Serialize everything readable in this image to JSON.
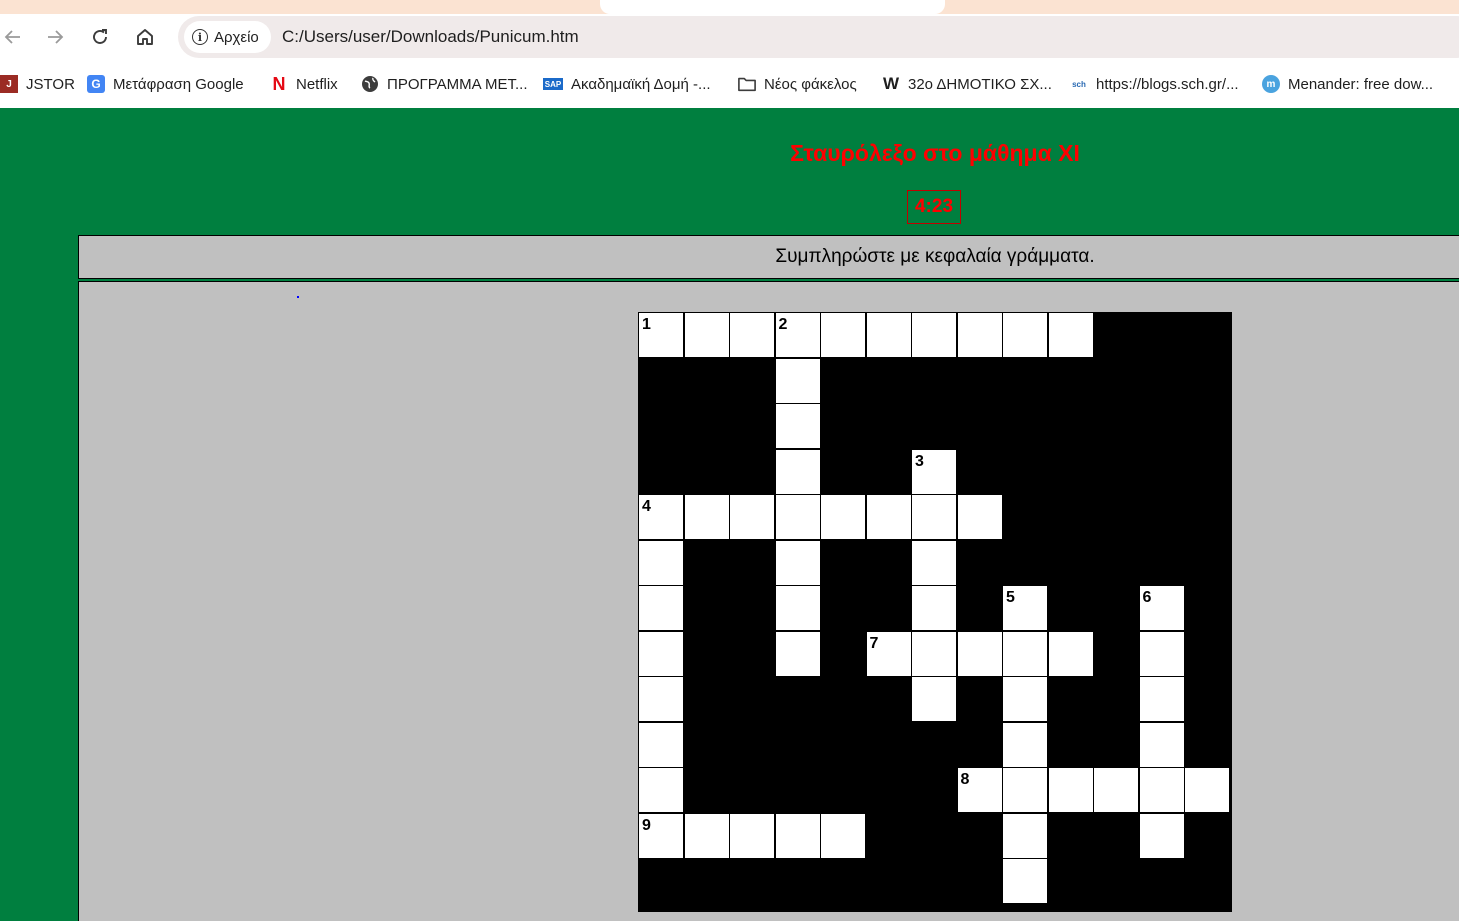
{
  "browser": {
    "nav": {
      "back_icon": "arrow-left-icon",
      "forward_icon": "arrow-right-icon",
      "reload_icon": "reload-icon",
      "home_icon": "home-icon"
    },
    "site_chip_label": "Αρχείο",
    "url": "C:/Users/user/Downloads/Punicum.htm"
  },
  "bookmarks": [
    {
      "label": "JSTOR",
      "icon": "jstor-icon"
    },
    {
      "label": "Μετάφραση Google",
      "icon": "google-translate-icon"
    },
    {
      "label": "Netflix",
      "icon": "netflix-icon"
    },
    {
      "label": "ΠΡΟΓΡΑΜΜΑ ΜΕΤ...",
      "icon": "globe-icon"
    },
    {
      "label": "Ακαδημαϊκή Δομή -...",
      "icon": "sap-icon"
    },
    {
      "label": "Νέος φάκελος",
      "icon": "folder-icon"
    },
    {
      "label": "32ο ΔΗΜΟΤΙΚΟ ΣΧ...",
      "icon": "weebly-icon"
    },
    {
      "label": "https://blogs.sch.gr/...",
      "icon": "sch-icon"
    },
    {
      "label": "Menander: free dow...",
      "icon": "book-icon"
    }
  ],
  "page": {
    "title": "Σταυρόλεξο στο μάθημα XI",
    "timer": "4:23",
    "instructions": "Συμπληρώστε με κεφαλαία γράμματα."
  },
  "crossword": {
    "rows": 13,
    "cols": 13,
    "white_cells": [
      [
        0,
        0
      ],
      [
        0,
        1
      ],
      [
        0,
        2
      ],
      [
        0,
        3
      ],
      [
        0,
        4
      ],
      [
        0,
        5
      ],
      [
        0,
        6
      ],
      [
        0,
        7
      ],
      [
        0,
        8
      ],
      [
        0,
        9
      ],
      [
        1,
        3
      ],
      [
        2,
        3
      ],
      [
        3,
        3
      ],
      [
        3,
        6
      ],
      [
        4,
        0
      ],
      [
        4,
        1
      ],
      [
        4,
        2
      ],
      [
        4,
        3
      ],
      [
        4,
        4
      ],
      [
        4,
        5
      ],
      [
        4,
        6
      ],
      [
        4,
        7
      ],
      [
        5,
        0
      ],
      [
        5,
        3
      ],
      [
        5,
        6
      ],
      [
        6,
        0
      ],
      [
        6,
        3
      ],
      [
        6,
        6
      ],
      [
        6,
        8
      ],
      [
        6,
        11
      ],
      [
        7,
        0
      ],
      [
        7,
        3
      ],
      [
        7,
        5
      ],
      [
        7,
        6
      ],
      [
        7,
        7
      ],
      [
        7,
        8
      ],
      [
        7,
        9
      ],
      [
        7,
        11
      ],
      [
        8,
        0
      ],
      [
        8,
        6
      ],
      [
        8,
        8
      ],
      [
        8,
        11
      ],
      [
        9,
        0
      ],
      [
        9,
        8
      ],
      [
        9,
        11
      ],
      [
        10,
        0
      ],
      [
        10,
        7
      ],
      [
        10,
        8
      ],
      [
        10,
        9
      ],
      [
        10,
        10
      ],
      [
        10,
        11
      ],
      [
        10,
        12
      ],
      [
        11,
        0
      ],
      [
        11,
        1
      ],
      [
        11,
        2
      ],
      [
        11,
        3
      ],
      [
        11,
        4
      ],
      [
        11,
        8
      ],
      [
        11,
        11
      ],
      [
        12,
        8
      ]
    ],
    "clue_numbers": [
      {
        "n": "1",
        "r": 0,
        "c": 0
      },
      {
        "n": "2",
        "r": 0,
        "c": 3
      },
      {
        "n": "3",
        "r": 3,
        "c": 6
      },
      {
        "n": "4",
        "r": 4,
        "c": 0
      },
      {
        "n": "5",
        "r": 6,
        "c": 8
      },
      {
        "n": "6",
        "r": 6,
        "c": 11
      },
      {
        "n": "7",
        "r": 7,
        "c": 5
      },
      {
        "n": "8",
        "r": 10,
        "c": 7
      },
      {
        "n": "9",
        "r": 11,
        "c": 0
      }
    ]
  }
}
